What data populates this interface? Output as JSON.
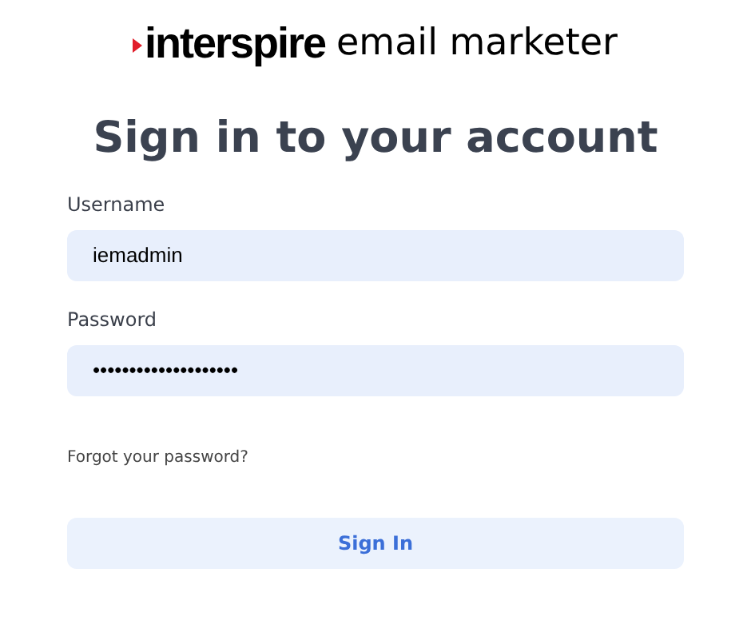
{
  "logo": {
    "brand": "interspire",
    "product": "email marketer"
  },
  "heading": "Sign in to your account",
  "fields": [
    {
      "label": "Username",
      "value": "iemadmin"
    },
    {
      "label": "Password",
      "value": "••••••••••••••••••••"
    }
  ],
  "forgot_link": "Forgot your password?",
  "submit_button": "Sign In"
}
